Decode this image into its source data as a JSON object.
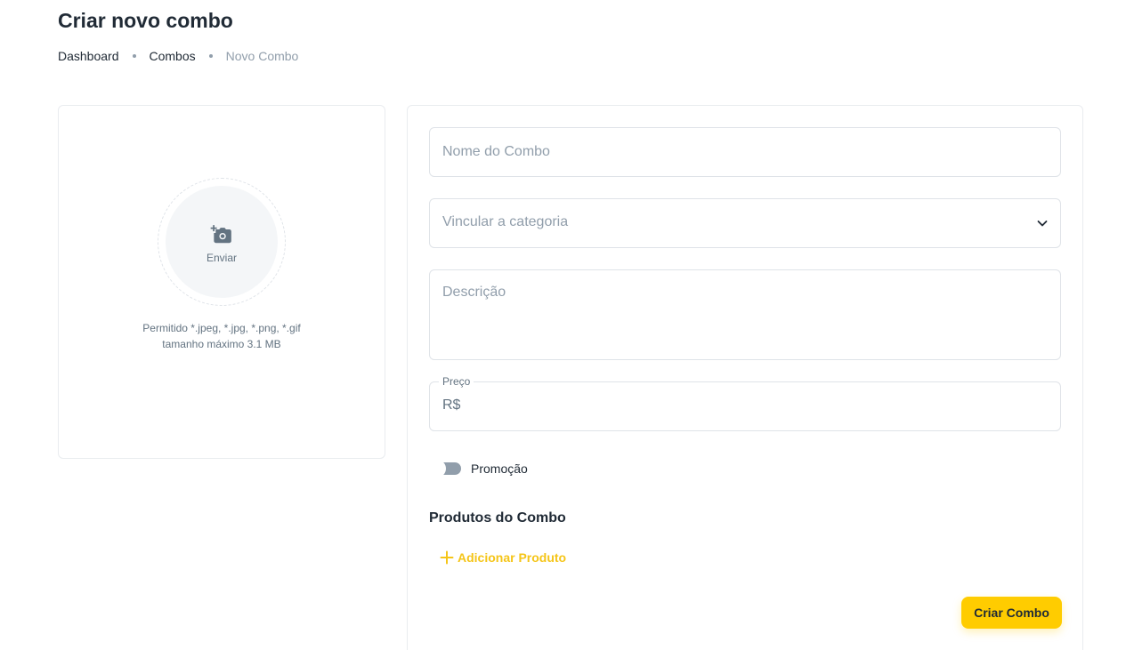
{
  "page": {
    "title": "Criar novo combo"
  },
  "breadcrumb": {
    "items": [
      "Dashboard",
      "Combos",
      "Novo Combo"
    ]
  },
  "upload": {
    "icon": "add-photo-icon",
    "label": "Enviar",
    "allowed": "Permitido *.jpeg, *.jpg, *.png, *.gif",
    "max_size": "tamanho máximo 3.1 MB"
  },
  "form": {
    "name_placeholder": "Nome do Combo",
    "name_value": "",
    "category_placeholder": "Vincular a categoria",
    "description_placeholder": "Descrição",
    "description_value": "",
    "price_label": "Preço",
    "price_prefix": "R$",
    "price_value": "",
    "promotion_label": "Promoção",
    "promotion_enabled": false,
    "products_title": "Produtos do Combo",
    "add_product_label": "Adicionar Produto",
    "submit_label": "Criar Combo"
  },
  "colors": {
    "accent": "#FFCC00",
    "accent_text": "#F5C518",
    "muted": "#919EAB",
    "text": "#212B36"
  }
}
